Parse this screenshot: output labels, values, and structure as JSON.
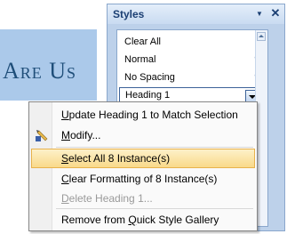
{
  "document": {
    "heading_text": "Are Us"
  },
  "styles_pane": {
    "title": "Styles",
    "close_icon": "close-icon",
    "dropdown_icon": "chevron-down-icon",
    "items": [
      {
        "label": "Clear All",
        "mark": ""
      },
      {
        "label": "Normal",
        "mark": "¶"
      },
      {
        "label": "No Spacing",
        "mark": "¶"
      }
    ],
    "selected_item": {
      "label": "Heading 1"
    }
  },
  "context_menu": {
    "items": [
      {
        "pre": "",
        "key": "U",
        "post": "pdate Heading 1 to Match Selection"
      },
      {
        "pre": "",
        "key": "M",
        "post": "odify...",
        "icon": "modify-style-icon"
      },
      {
        "pre": "",
        "key": "S",
        "post": "elect All 8 Instance(s)"
      },
      {
        "pre": "",
        "key": "C",
        "post": "lear Formatting of 8 Instance(s)"
      },
      {
        "pre": "",
        "key": "D",
        "post": "elete Heading 1..."
      },
      {
        "pre": "Remove from ",
        "key": "Q",
        "post": "uick Style Gallery"
      }
    ]
  },
  "colors": {
    "heading_fill": "#abc9ea",
    "heading_text": "#1f4e79",
    "pane_bg": "#bdd1ea",
    "menu_highlight": "#f9d98a"
  }
}
